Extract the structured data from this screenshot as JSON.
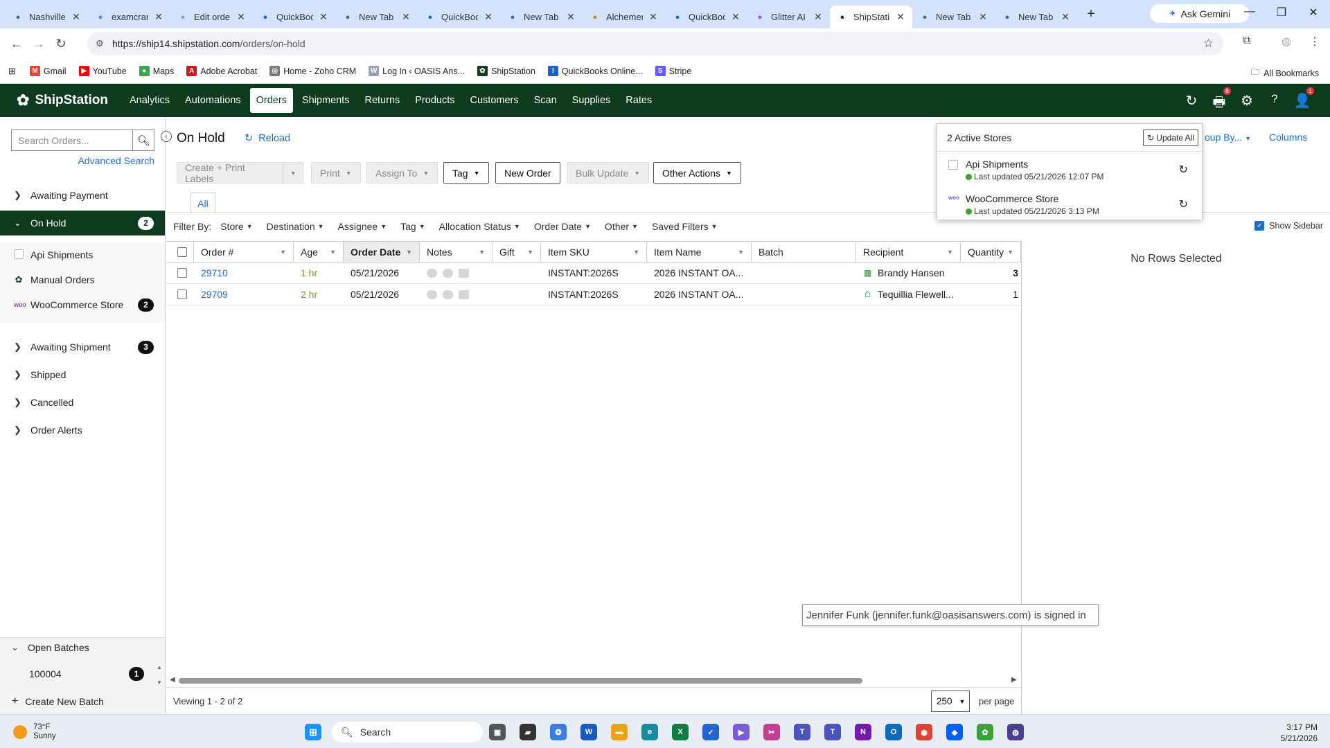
{
  "browser": {
    "tabs": [
      {
        "label": "Nashville",
        "icon": "globe-icon",
        "color": "#5f6368"
      },
      {
        "label": "examcram",
        "icon": "google-icon",
        "color": "#4285f4"
      },
      {
        "label": "Edit orde",
        "icon": "wordpress-icon",
        "color": "#9aa0b0"
      },
      {
        "label": "QuickBoo",
        "icon": "quickbooks-icon",
        "color": "#1b5fd6"
      },
      {
        "label": "New Tab",
        "icon": "globe-icon",
        "color": "#5f6368"
      },
      {
        "label": "QuickBoo",
        "icon": "quickbooks-icon",
        "color": "#1b5fd6"
      },
      {
        "label": "New Tab",
        "icon": "globe-icon",
        "color": "#5f6368"
      },
      {
        "label": "Alchemer",
        "icon": "alchemer-icon",
        "color": "#e8742b"
      },
      {
        "label": "QuickBoo",
        "icon": "quickbooks-icon",
        "color": "#1b5fd6"
      },
      {
        "label": "Glitter AI",
        "icon": "glitter-icon",
        "color": "#8a5cf0"
      },
      {
        "label": "ShipStati",
        "icon": "shipstation-icon",
        "color": "#0e3b1e",
        "active": true
      },
      {
        "label": "New Tab",
        "icon": "globe-icon",
        "color": "#5f6368"
      },
      {
        "label": "New Tab",
        "icon": "globe-icon",
        "color": "#5f6368"
      }
    ],
    "gemini_label": "Ask Gemini",
    "url_host": "https://ship14.shipstation.com",
    "url_path": "/orders/on-hold",
    "bookmarks": [
      {
        "label": "Gmail",
        "color": "#ea4335",
        "glyph": "M"
      },
      {
        "label": "YouTube",
        "color": "#ff0000",
        "glyph": "▶"
      },
      {
        "label": "Maps",
        "color": "#34a853",
        "glyph": "●"
      },
      {
        "label": "Adobe Acrobat",
        "color": "#d4151c",
        "glyph": "A"
      },
      {
        "label": "Home - Zoho CRM",
        "color": "#7a7a7a",
        "glyph": "◎"
      },
      {
        "label": "Log In ‹ OASIS Ans...",
        "color": "#9aa0b0",
        "glyph": "W"
      },
      {
        "label": "ShipStation",
        "color": "#0e3b1e",
        "glyph": "✿"
      },
      {
        "label": "QuickBooks Online...",
        "color": "#1b5fd6",
        "glyph": "I"
      },
      {
        "label": "Stripe",
        "color": "#635bff",
        "glyph": "S"
      }
    ],
    "all_bookmarks": "All Bookmarks"
  },
  "app": {
    "brand": "ShipStation",
    "nav": [
      "Analytics",
      "Automations",
      "Orders",
      "Shipments",
      "Returns",
      "Products",
      "Customers",
      "Scan",
      "Supplies",
      "Rates"
    ],
    "active_nav": "Orders",
    "print_badge": "8",
    "user_badge": "1"
  },
  "sidebar": {
    "search_placeholder": "Search Orders...",
    "advanced_search": "Advanced Search",
    "items": [
      {
        "label": "Awaiting Payment",
        "count": ""
      },
      {
        "label": "On Hold",
        "count": "2"
      },
      {
        "label": "Awaiting Shipment",
        "count": "3"
      },
      {
        "label": "Shipped",
        "count": ""
      },
      {
        "label": "Cancelled",
        "count": ""
      },
      {
        "label": "Order Alerts",
        "count": ""
      }
    ],
    "stores": [
      {
        "label": "Api Shipments",
        "count": ""
      },
      {
        "label": "Manual Orders",
        "count": ""
      },
      {
        "label": "WooCommerce Store",
        "count": "2"
      }
    ],
    "open_batches": "Open Batches",
    "batch_id": "100004",
    "batch_count": "1",
    "create_batch": "Create New Batch"
  },
  "main": {
    "title": "On Hold",
    "reload": "Reload",
    "group_by": "oup By...",
    "columns": "Columns",
    "buttons": {
      "create_print": "Create + Print Labels",
      "print": "Print",
      "assign_to": "Assign To",
      "tag": "Tag",
      "new_order": "New Order",
      "bulk_update": "Bulk Update",
      "other_actions": "Other Actions"
    },
    "all_tab": "All",
    "filter_by": "Filter By:",
    "filters": [
      "Store",
      "Destination",
      "Assignee",
      "Tag",
      "Allocation Status",
      "Order Date",
      "Other",
      "Saved Filters"
    ],
    "show_sidebar": "Show Sidebar",
    "columns_list": [
      "Order #",
      "Age",
      "Order Date",
      "Notes",
      "Gift",
      "Item SKU",
      "Item Name",
      "Batch",
      "Recipient",
      "Quantity"
    ],
    "rows": [
      {
        "order": "29710",
        "age": "1 hr",
        "date": "05/21/2026",
        "sku": "INSTANT:2026S",
        "item": "2026 INSTANT OA...",
        "batch": "",
        "recipient": "Brandy Hansen",
        "qty": "3",
        "recipient_icon": "building-icon"
      },
      {
        "order": "29709",
        "age": "2 hr",
        "date": "05/21/2026",
        "sku": "INSTANT:2026S",
        "item": "2026 INSTANT OA...",
        "batch": "",
        "recipient": "Tequillia Flewell...",
        "qty": "1",
        "recipient_icon": "house-icon"
      }
    ],
    "no_rows": "No Rows Selected",
    "viewing": "Viewing 1 - 2 of 2",
    "per_page_value": "250",
    "per_page_label": "per page"
  },
  "stores_popup": {
    "title": "2 Active Stores",
    "update_all": "Update All",
    "stores": [
      {
        "name": "Api Shipments",
        "updated": "Last updated 05/21/2026 12:07 PM"
      },
      {
        "name": "WooCommerce Store",
        "updated": "Last updated 05/21/2026 3:13 PM"
      }
    ]
  },
  "tooltip": "Jennifer Funk (jennifer.funk@oasisanswers.com) is signed in",
  "taskbar": {
    "temp": "73°F",
    "condition": "Sunny",
    "search": "Search",
    "time": "3:17 PM",
    "date": "5/21/2026"
  }
}
